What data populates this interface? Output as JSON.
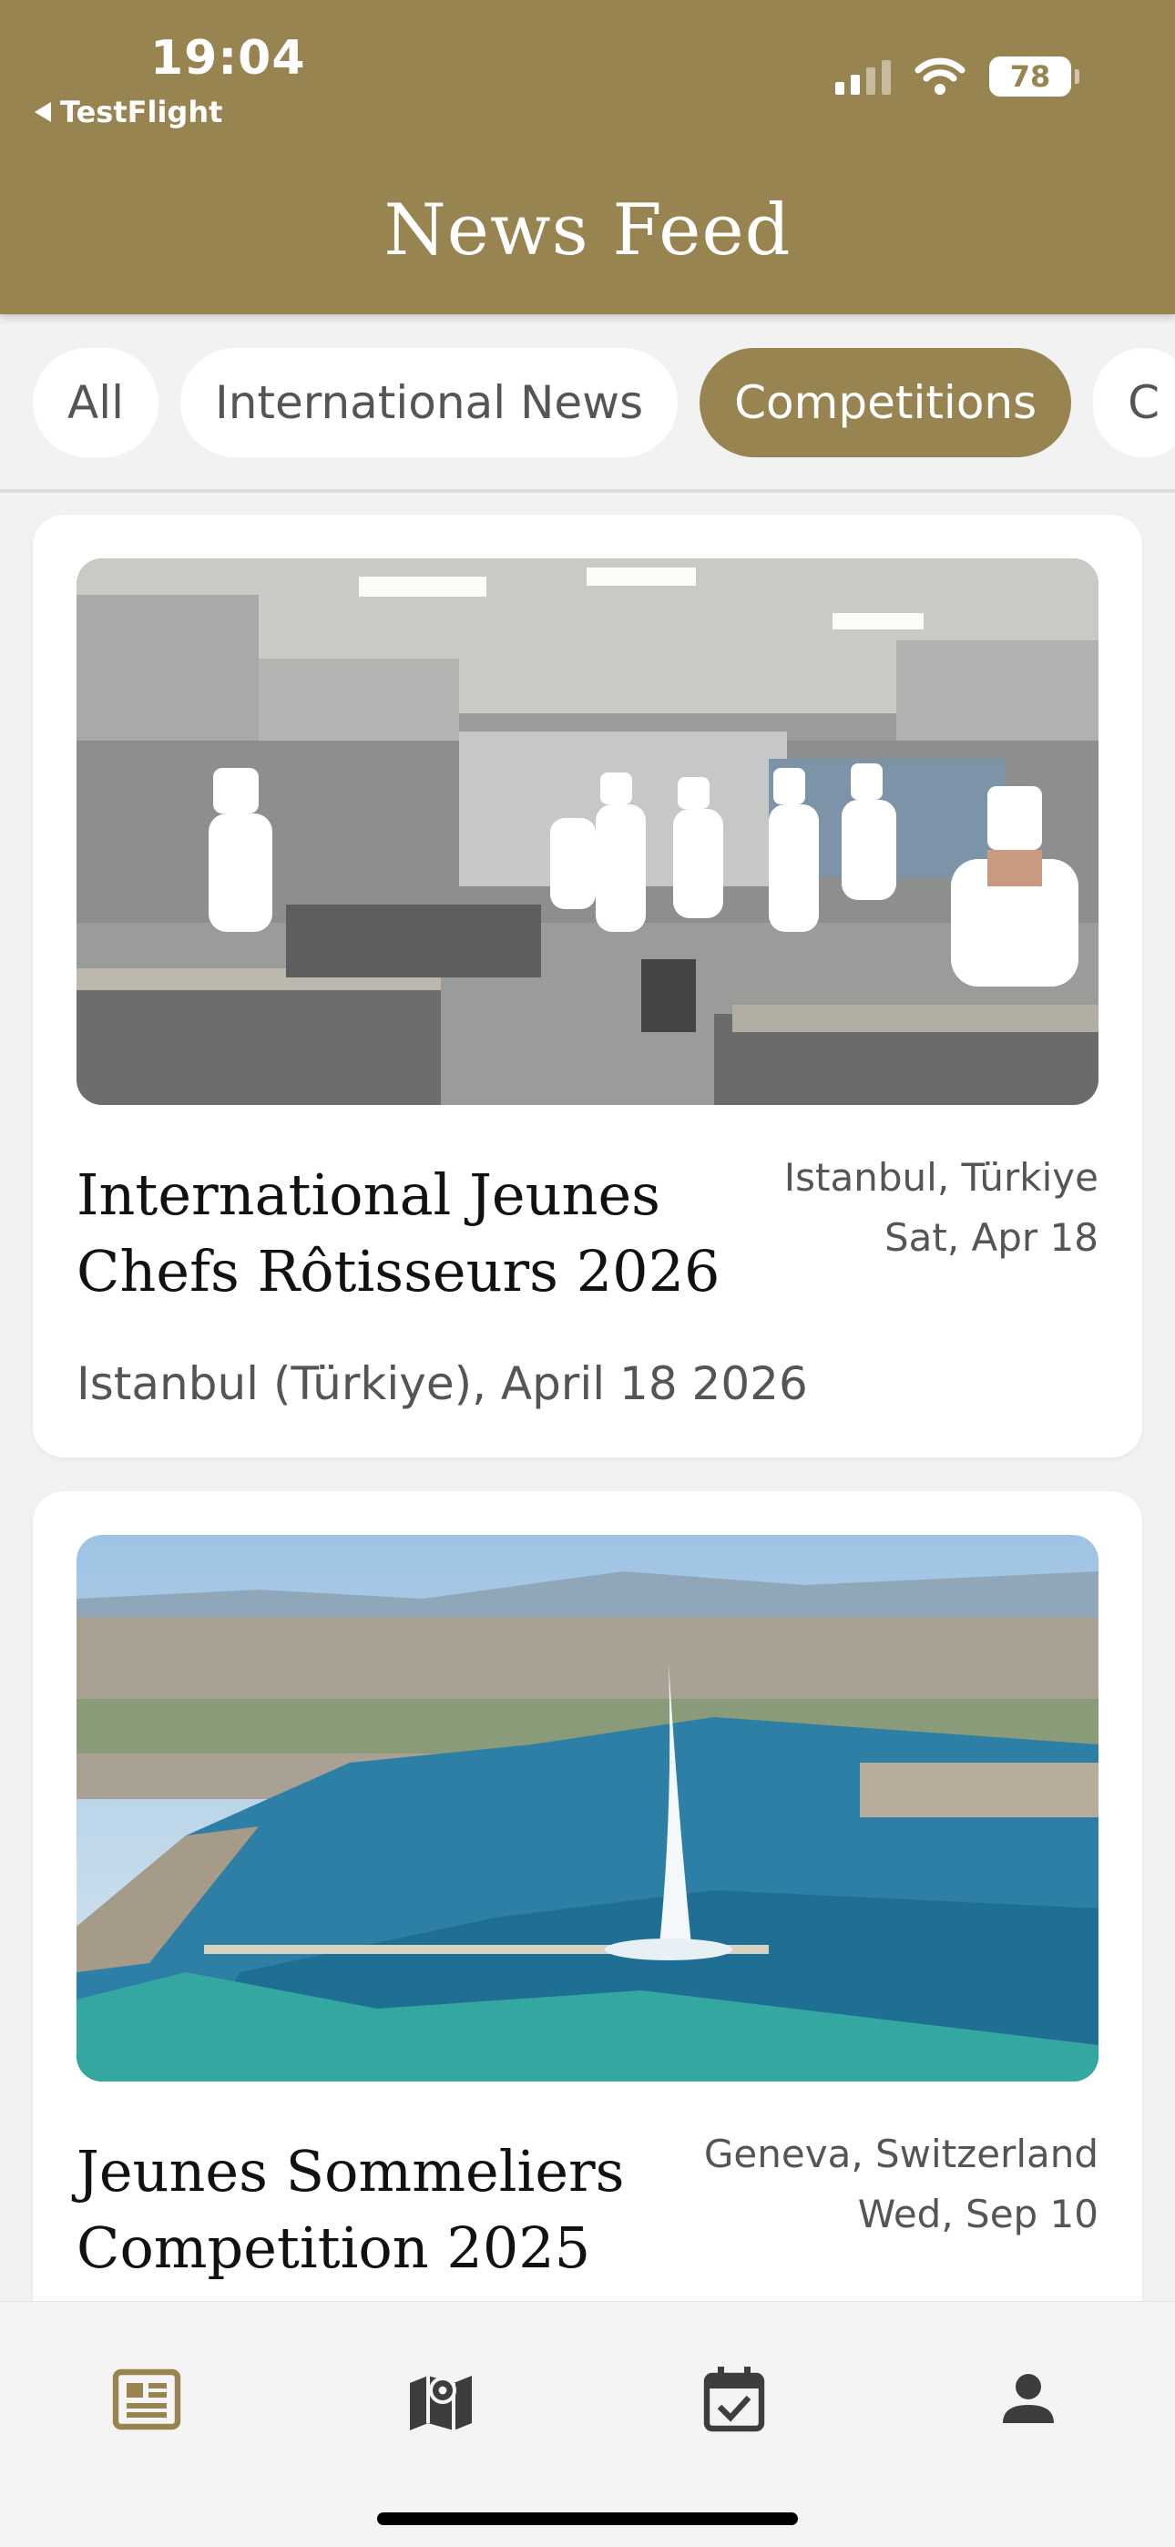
{
  "status_bar": {
    "time": "19:04",
    "back_app": "TestFlight",
    "battery": "78"
  },
  "header": {
    "title": "News Feed"
  },
  "filters": {
    "chips": [
      {
        "label": "All",
        "active": false
      },
      {
        "label": "International News",
        "active": false
      },
      {
        "label": "Competitions",
        "active": true
      },
      {
        "label": "C",
        "active": false
      }
    ]
  },
  "feed": {
    "cards": [
      {
        "title": "International Jeunes Chefs Rôtisseurs 2026",
        "location": "Istanbul, Türkiye",
        "date": "Sat, Apr 18",
        "description": "Istanbul (Türkiye), April 18 2026",
        "image": "kitchen-competition-photo"
      },
      {
        "title": "Jeunes Sommeliers Competition 2025",
        "location": "Geneva, Switzerland",
        "date": "Wed, Sep 10",
        "description": "",
        "image": "geneva-lake-fountain-photo"
      }
    ]
  },
  "tabbar": {
    "tabs": [
      {
        "icon": "news-icon",
        "active": true
      },
      {
        "icon": "map-icon",
        "active": false
      },
      {
        "icon": "calendar-check-icon",
        "active": false
      },
      {
        "icon": "person-icon",
        "active": false
      }
    ]
  },
  "colors": {
    "brand": "#978450",
    "tab_active": "#978450",
    "tab_inactive": "#3d3d3d"
  }
}
